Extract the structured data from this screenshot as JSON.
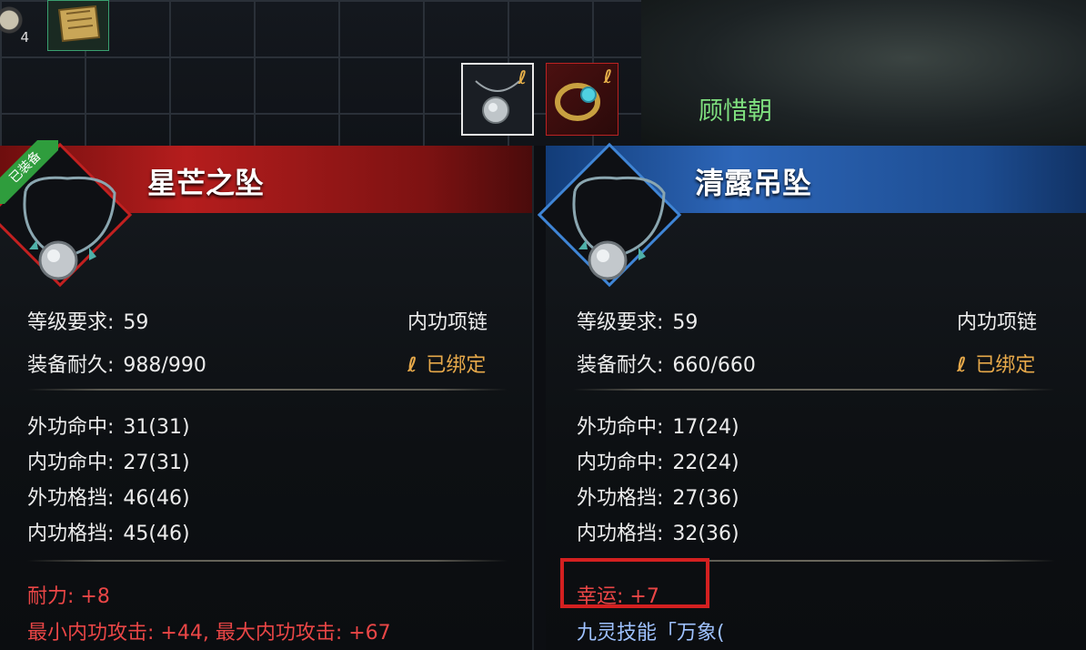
{
  "inventory": {
    "slot_count": "4"
  },
  "character": {
    "name": "顾惜朝"
  },
  "left_item": {
    "badge": "已装备",
    "name": "星芒之坠",
    "level_label": "等级要求:",
    "level": "59",
    "type": "内功项链",
    "durability_label": "装备耐久:",
    "durability": "988/990",
    "bound": "已绑定",
    "stats": [
      {
        "label": "外功命中:",
        "value": "31(31)"
      },
      {
        "label": "内功命中:",
        "value": "27(31)"
      },
      {
        "label": "外功格挡:",
        "value": "46(46)"
      },
      {
        "label": "内功格挡:",
        "value": "45(46)"
      }
    ],
    "bonus1": "耐力: +8",
    "bonus2": "最小内功攻击: +44, 最大内功攻击: +67"
  },
  "right_item": {
    "name": "清露吊坠",
    "level_label": "等级要求:",
    "level": "59",
    "type": "内功项链",
    "durability_label": "装备耐久:",
    "durability": "660/660",
    "bound": "已绑定",
    "stats": [
      {
        "label": "外功命中:",
        "value": "17(24)"
      },
      {
        "label": "内功命中:",
        "value": "22(24)"
      },
      {
        "label": "外功格挡:",
        "value": "27(36)"
      },
      {
        "label": "内功格挡:",
        "value": "32(36)"
      }
    ],
    "bonus1": "幸运: +7",
    "skill": "九灵技能「万象("
  },
  "colors": {
    "left_header": "#b51d1d",
    "right_header": "#2d66b8",
    "bound_gold": "#e7a94a",
    "bonus_red": "#ea4646",
    "name_green": "#7fe07f",
    "highlight": "#d42020"
  }
}
